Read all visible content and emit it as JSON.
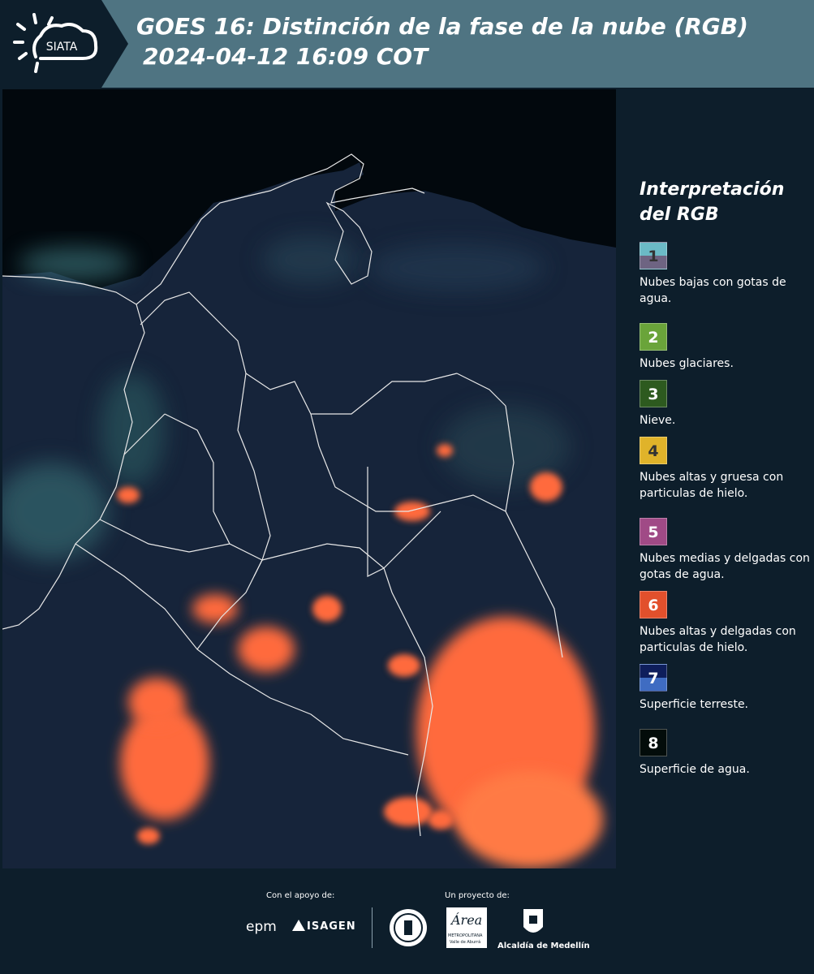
{
  "header": {
    "logo_text": "SIATA",
    "title_line1": "GOES 16: Distinción de la fase de la nube (RGB)",
    "title_line2": "2024-04-12 16:09 COT"
  },
  "legend": {
    "title": "Interpretación del RGB",
    "items": [
      {
        "num": "1",
        "label": "Nubes bajas con gotas de agua.",
        "color_top": "#6bbac6",
        "color_bottom": "#6e6482"
      },
      {
        "num": "2",
        "label": "Nubes glaciares.",
        "color_top": "#6aa43a",
        "color_bottom": "#6aa43a"
      },
      {
        "num": "3",
        "label": "Nieve.",
        "color_top": "#2d5a1f",
        "color_bottom": "#2d5a1f"
      },
      {
        "num": "4",
        "label": "Nubes altas y gruesa con particulas de hielo.",
        "color_top": "#e0b32a",
        "color_bottom": "#e0b32a"
      },
      {
        "num": "5",
        "label": "Nubes medias y delgadas con gotas de agua.",
        "color_top": "#a04a86",
        "color_bottom": "#a04a86"
      },
      {
        "num": "6",
        "label": "Nubes altas y delgadas con particulas de hielo.",
        "color_top": "#e2502c",
        "color_bottom": "#e2502c"
      },
      {
        "num": "7",
        "label": "Superficie terreste.",
        "color_top": "#0e1e5c",
        "color_bottom": "#3f6cc2"
      },
      {
        "num": "8",
        "label": "Superficie de agua.",
        "color_top": "#030c0a",
        "color_bottom": "#030c0a"
      }
    ]
  },
  "footer": {
    "support_caption": "Con el apoyo de:",
    "project_caption": "Un proyecto de:",
    "epm": "epm",
    "isagen": "ISAGEN",
    "area_name": "Área",
    "area_sub": "METROPOLITANA",
    "area_sub2": "Valle de Aburrá",
    "alcaldia": "Alcaldía de Medellín"
  },
  "colors": {
    "background": "#0d1e2b",
    "header_band": "#4f7482",
    "ocean": "#02080d",
    "land": "#16233a",
    "cloud_hot": "#ff6a3d",
    "cloud_low": "#4a8f96"
  }
}
